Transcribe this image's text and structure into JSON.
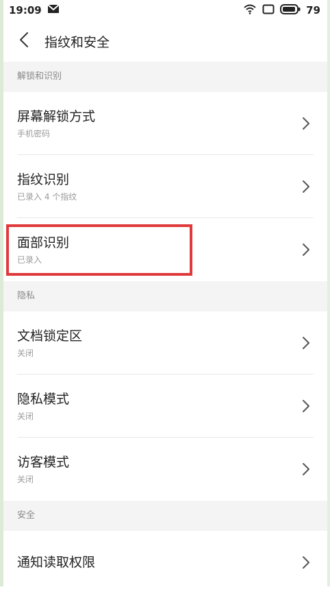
{
  "status_bar": {
    "time": "19:09",
    "battery": "79",
    "icons": [
      "mail-icon",
      "wifi-icon",
      "screen-icon",
      "battery-icon"
    ]
  },
  "header": {
    "title": "指纹和安全",
    "back_icon": "chevron-left-icon"
  },
  "sections": [
    {
      "label": "解锁和识别",
      "items": [
        {
          "title": "屏幕解锁方式",
          "subtitle": "手机密码"
        },
        {
          "title": "指纹识别",
          "subtitle": "已录入 4 个指纹"
        },
        {
          "title": "面部识别",
          "subtitle": "已录入"
        }
      ]
    },
    {
      "label": "隐私",
      "items": [
        {
          "title": "文档锁定区",
          "subtitle": "关闭"
        },
        {
          "title": "隐私模式",
          "subtitle": "关闭"
        },
        {
          "title": "访客模式",
          "subtitle": "关闭"
        }
      ]
    },
    {
      "label": "安全",
      "items": [
        {
          "title": "通知读取权限",
          "subtitle": ""
        }
      ]
    }
  ],
  "colors": {
    "highlight": "#e0393c",
    "section_bg": "#f4f4f4",
    "subtitle": "#9a9a9a"
  }
}
